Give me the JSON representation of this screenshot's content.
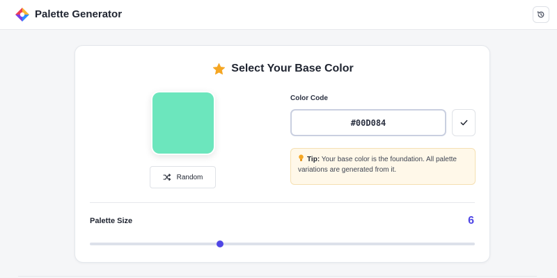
{
  "header": {
    "title": "Palette Generator",
    "logo_icon": "color-wheel-logo-icon",
    "history_icon": "history-icon"
  },
  "selector": {
    "title": "Select Your Base Color",
    "title_icon": "star-icon",
    "swatch_color": "#00D084",
    "swatch_display_color": "#6ce6bd",
    "random_label": "Random",
    "random_icon": "shuffle-icon",
    "color_code_label": "Color Code",
    "color_code_value": "#00D084",
    "confirm_icon": "check-icon",
    "tip": {
      "icon": "lightbulb-icon",
      "strong": "Tip:",
      "text": "Your base color is the foundation. All palette variations are generated from it."
    },
    "palette_size": {
      "label": "Palette Size",
      "value": "6",
      "fraction": 0.3382
    }
  },
  "colors": {
    "accent": "#4f46e5",
    "star": "#f5a623"
  }
}
